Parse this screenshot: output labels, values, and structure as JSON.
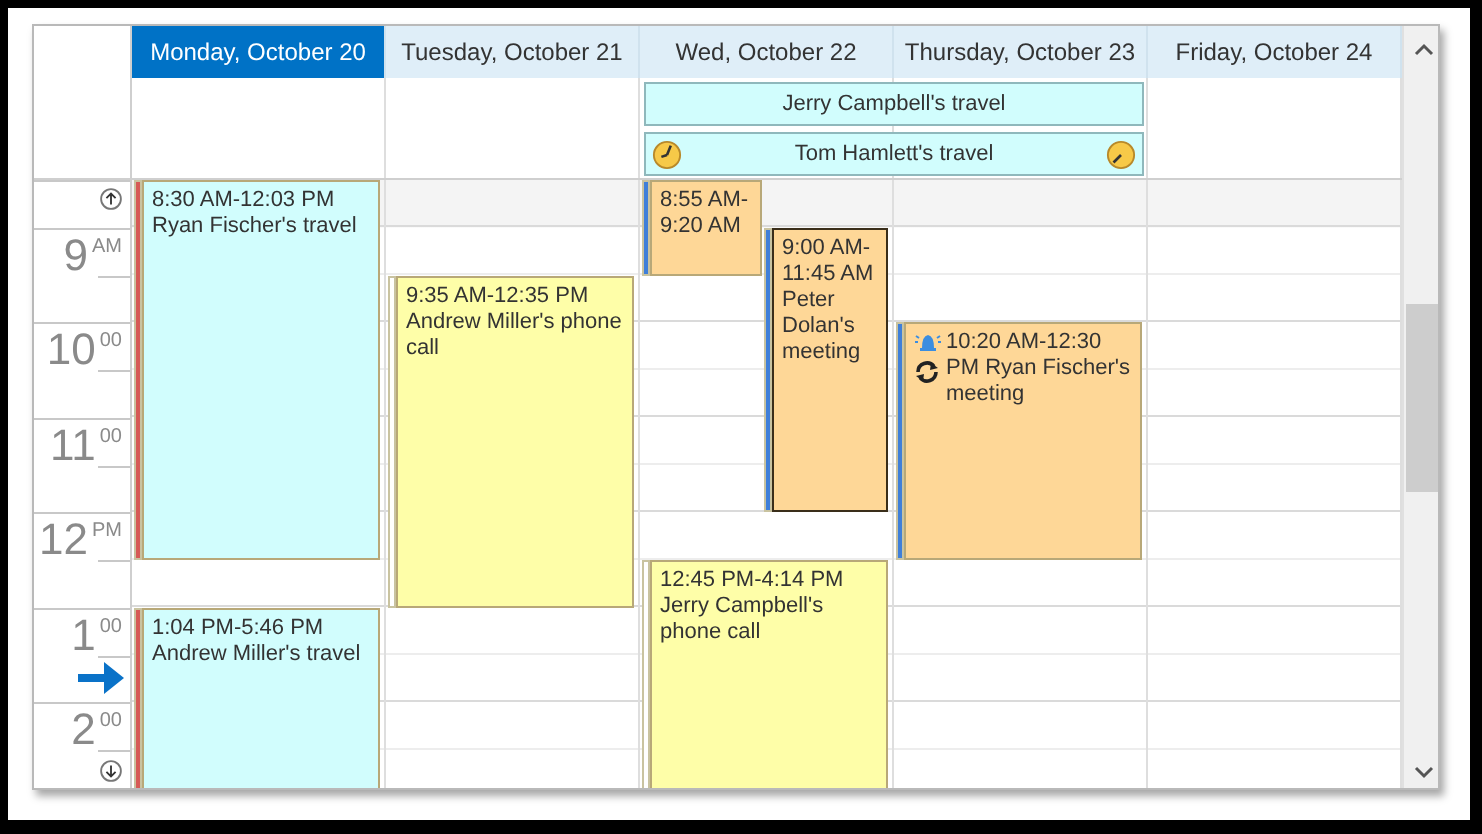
{
  "days": [
    {
      "label": "Monday, October 20",
      "selected": true,
      "appointments": [
        {
          "time": "8:30 AM-12:03 PM",
          "subject": "Ryan Fischer's travel",
          "kind": "stacked",
          "color": "#d1fdfd",
          "selected": false,
          "reminder": false,
          "recurring": false
        },
        {
          "time": "1:04 PM-5:46 PM",
          "subject": "Andrew Miller's travel",
          "kind": "stacked",
          "color": "#d1fdfd",
          "selected": false,
          "reminder": false,
          "recurring": false
        }
      ]
    },
    {
      "label": "Tuesday, October 21",
      "selected": false,
      "appointments": [
        {
          "time": "9:35 AM-12:35 PM",
          "subject": "Andrew Miller's phone call",
          "kind": "stacked",
          "color": "#fefea8",
          "selected": false,
          "reminder": false,
          "recurring": false
        }
      ]
    },
    {
      "label": "Wed, October 22",
      "selected": false,
      "appointments": [
        {
          "time": "8:55 AM-9:20 AM",
          "color": "#fed797",
          "selected": false,
          "reminder": false,
          "recurring": false
        },
        {
          "time": "9:00 AM-11:45 AM",
          "subject": "Peter Dolan's meeting",
          "kind": "flow",
          "color": "#fed797",
          "selected": true,
          "reminder": false,
          "recurring": false
        },
        {
          "time": "12:45 PM-4:14 PM",
          "subject": "Jerry Campbell's phone call",
          "kind": "stacked",
          "color": "#fefea8",
          "selected": false,
          "reminder": false,
          "recurring": false
        }
      ]
    },
    {
      "label": "Thursday, October 23",
      "selected": false,
      "appointments": [
        {
          "time": "10:20 AM-12:30 PM",
          "subject": "Ryan Fischer's meeting",
          "kind": "flow",
          "color": "#fed797",
          "selected": false,
          "reminder": true,
          "recurring": true
        }
      ]
    },
    {
      "label": "Friday, October 24",
      "selected": false
    }
  ],
  "all_day_events": [
    {
      "subject": "Jerry Campbell's travel",
      "color": "#d1fdfd",
      "continues_before": false,
      "continues_after": false
    },
    {
      "subject": "Tom Hamlett's travel",
      "color": "#d1fdfd",
      "continues_before": true,
      "continues_after": true
    }
  ],
  "time_ruler": {
    "hours": [
      {
        "hour": "9",
        "suffix": "AM"
      },
      {
        "hour": "10",
        "suffix": "00"
      },
      {
        "hour": "11",
        "suffix": "00"
      },
      {
        "hour": "12",
        "suffix": "PM"
      },
      {
        "hour": "1",
        "suffix": "00"
      },
      {
        "hour": "2",
        "suffix": "00"
      }
    ]
  }
}
